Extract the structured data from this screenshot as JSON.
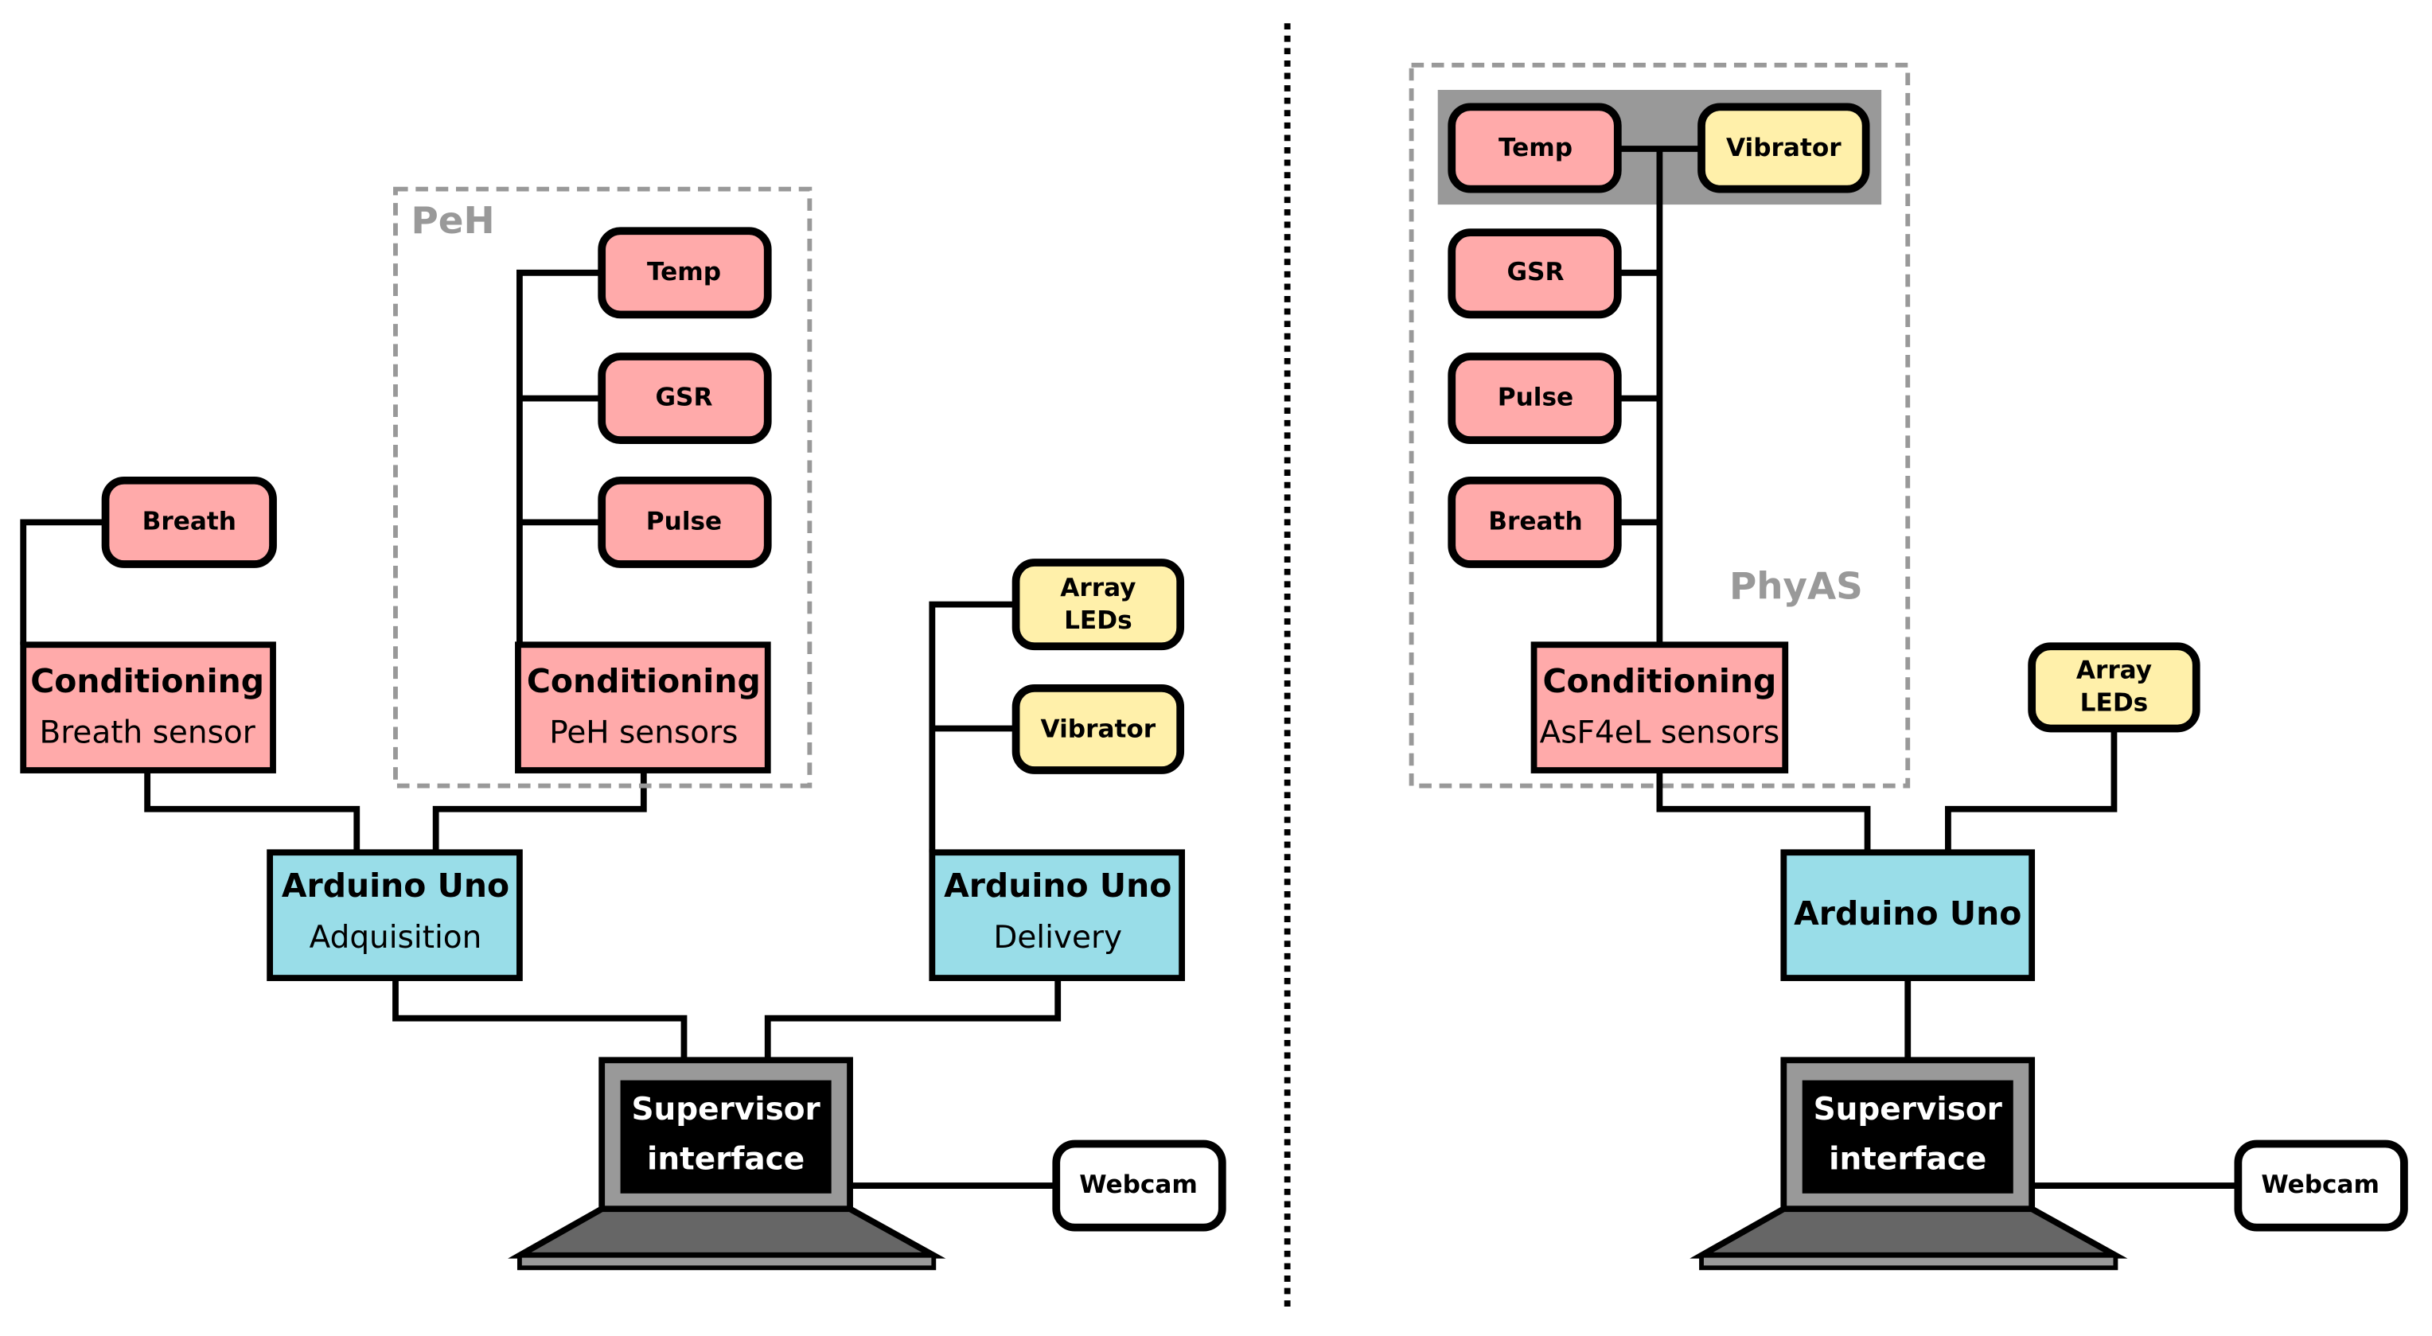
{
  "left": {
    "group_label": "PeH",
    "breath_sensor": "Breath",
    "conditioning_breath": {
      "title": "Conditioning",
      "subtitle": "Breath sensor"
    },
    "peh_sensors": [
      "Temp",
      "GSR",
      "Pulse"
    ],
    "conditioning_peh": {
      "title": "Conditioning",
      "subtitle": "PeH sensors"
    },
    "arduino_acq": {
      "title": "Arduino Uno",
      "subtitle": "Adquisition"
    },
    "arduino_delivery": {
      "title": "Arduino Uno",
      "subtitle": "Delivery"
    },
    "array_leds": [
      "Array",
      "LEDs"
    ],
    "vibrator": "Vibrator",
    "laptop": [
      "Supervisor",
      "interface"
    ],
    "webcam": "Webcam"
  },
  "right": {
    "group_label": "PhyAS",
    "temp": "Temp",
    "vibrator": "Vibrator",
    "sensors": [
      "GSR",
      "Pulse",
      "Breath"
    ],
    "conditioning": {
      "title": "Conditioning",
      "subtitle": "AsF4eL sensors"
    },
    "arduino": "Arduino Uno",
    "array_leds": [
      "Array",
      "LEDs"
    ],
    "laptop": [
      "Supervisor",
      "interface"
    ],
    "webcam": "Webcam"
  },
  "colors": {
    "sensor": "#ffaaaa",
    "actuator": "#fff0aa",
    "arduino": "#99dde8",
    "group": "#999999",
    "band": "#999999"
  }
}
